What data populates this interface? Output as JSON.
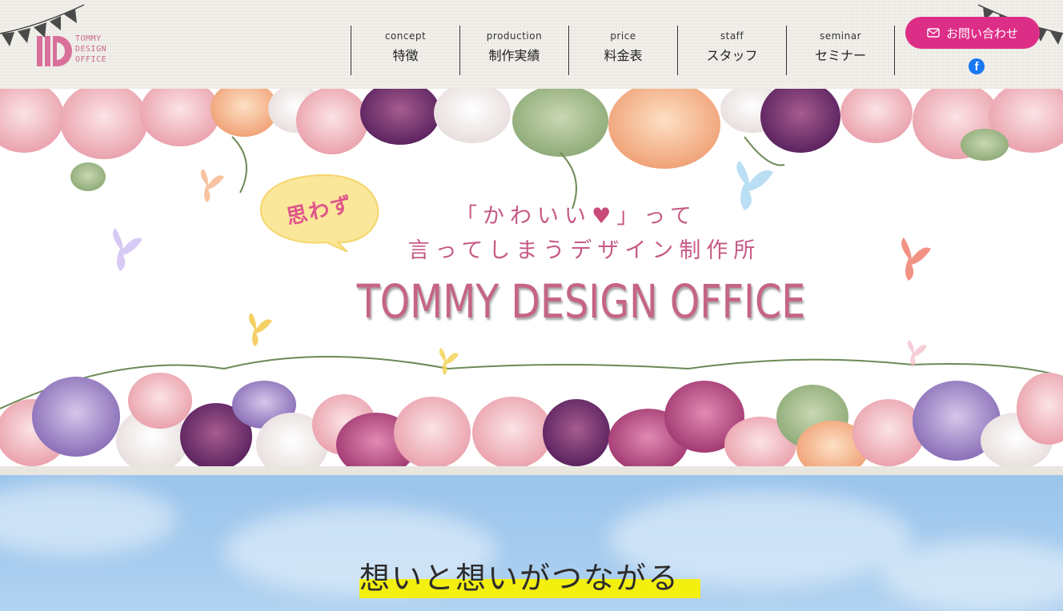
{
  "header": {
    "logo": {
      "lines": [
        "TOMMY",
        "DESIGN",
        "OFFICE"
      ]
    },
    "nav": [
      {
        "en": "concept",
        "ja": "特徴"
      },
      {
        "en": "production",
        "ja": "制作実績"
      },
      {
        "en": "price",
        "ja": "料金表"
      },
      {
        "en": "staff",
        "ja": "スタッフ"
      },
      {
        "en": "seminar",
        "ja": "セミナー"
      }
    ],
    "contact_label": "お問い合わせ",
    "facebook_glyph": "f"
  },
  "hero": {
    "bubble_text": "思わず",
    "tagline_line1_before": "「かわいい",
    "tagline_line1_after": "」って",
    "heart_glyph": "♥",
    "tagline_line2": "言ってしまうデザイン制作所",
    "brand": "TOMMY DESIGN OFFICE"
  },
  "section": {
    "title": "想いと想いがつながる"
  },
  "colors": {
    "accent_pink": "#dd2e87",
    "brand_pink": "#c56486",
    "highlight_yellow": "#f3ef0e",
    "sky_blue": "#9cc5ec",
    "facebook_blue": "#1877f2"
  }
}
